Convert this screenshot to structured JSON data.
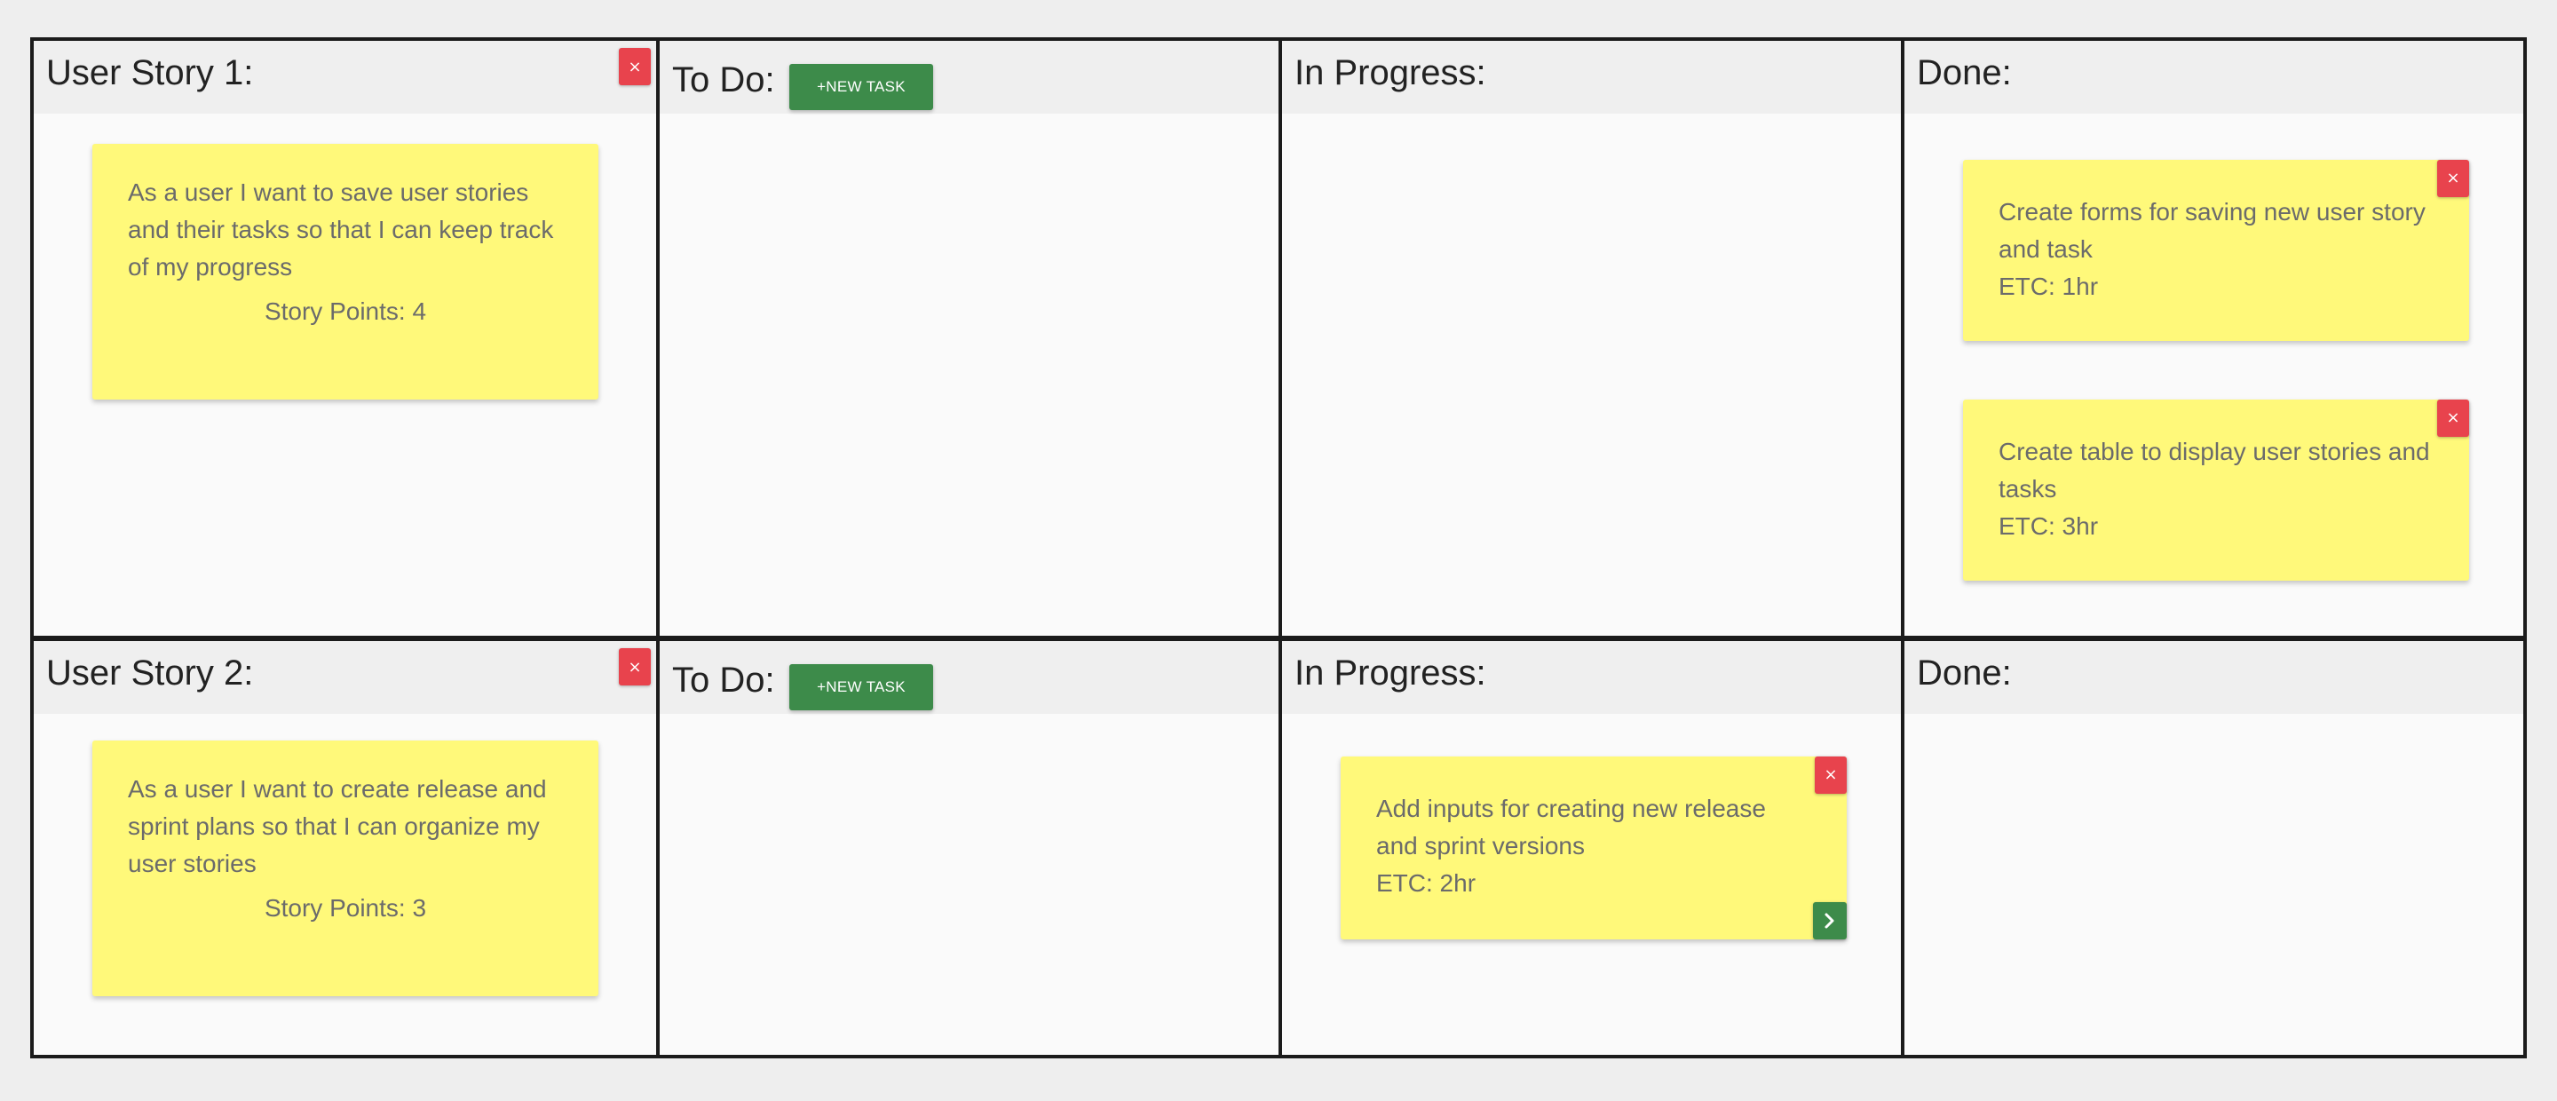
{
  "stories": [
    {
      "title": "User Story 1:",
      "text": "As a user I want to save user stories and their tasks so that I can keep track of my progress",
      "points_label": "Story Points: 4",
      "close_label": "×",
      "todo": {
        "title": "To Do:",
        "new_task_label": "+NEW TASK"
      },
      "in_progress": {
        "title": "In Progress:"
      },
      "done": {
        "title": "Done:",
        "tasks": [
          {
            "text": "Create forms for saving new user story and task",
            "etc": "ETC: 1hr",
            "close_label": "×"
          },
          {
            "text": "Create table to display user stories and tasks",
            "etc": "ETC: 3hr",
            "close_label": "×"
          }
        ]
      }
    },
    {
      "title": "User Story 2:",
      "text": "As a user I want to create release and sprint plans so that I can organize my user stories",
      "points_label": "Story Points: 3",
      "close_label": "×",
      "todo": {
        "title": "To Do:",
        "new_task_label": "+NEW TASK"
      },
      "in_progress": {
        "title": "In Progress:",
        "tasks": [
          {
            "text": "Add inputs for creating new release and sprint versions",
            "etc": "ETC: 2hr",
            "close_label": "×",
            "move_icon": "chevron-right-icon"
          }
        ]
      },
      "done": {
        "title": "Done:"
      }
    }
  ],
  "colors": {
    "card": "#fff97a",
    "close": "#e8434d",
    "action": "#3d8b4a",
    "header": "#efefef",
    "border": "#1b1b1b"
  }
}
